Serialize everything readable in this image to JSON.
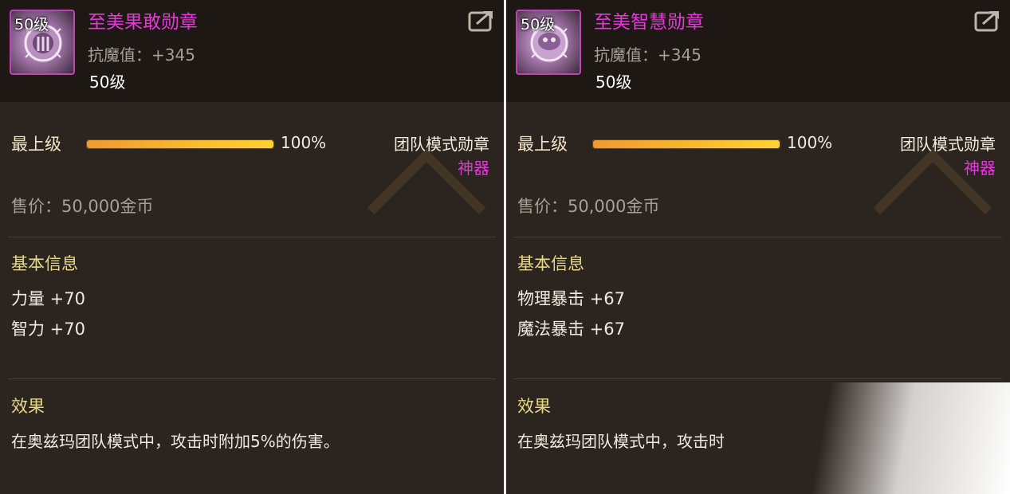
{
  "panels": [
    {
      "level_badge": "50级",
      "name": "至美果敢勋章",
      "header_stat": "抗魔值：+345",
      "level": "50级",
      "grade_label": "最上级",
      "grade_percent": "100%",
      "grade_fraction": 1.0,
      "medal_type": "团队模式勋章",
      "rarity": "神器",
      "price": "售价：50,000金币",
      "basic_info_title": "基本信息",
      "attributes": [
        "力量 +70",
        "智力 +70"
      ],
      "effect_title": "效果",
      "effect_text": "在奥兹玛团队模式中，攻击时附加5%的伤害。"
    },
    {
      "level_badge": "50级",
      "name": "至美智慧勋章",
      "header_stat": "抗魔值：+345",
      "level": "50级",
      "grade_label": "最上级",
      "grade_percent": "100%",
      "grade_fraction": 1.0,
      "medal_type": "团队模式勋章",
      "rarity": "神器",
      "price": "售价：50,000金币",
      "basic_info_title": "基本信息",
      "attributes": [
        "物理暴击 +67",
        "魔法暴击 +67"
      ],
      "effect_title": "效果",
      "effect_text": "在奥兹玛团队模式中，攻击时"
    }
  ],
  "colors": {
    "item_name": "#e23ad8",
    "rarity": "#e23ad8",
    "section_title": "#e6d98a",
    "bar_fill": "#ffd234"
  },
  "icons": {
    "item": "medal-icon",
    "share": "share-icon"
  }
}
